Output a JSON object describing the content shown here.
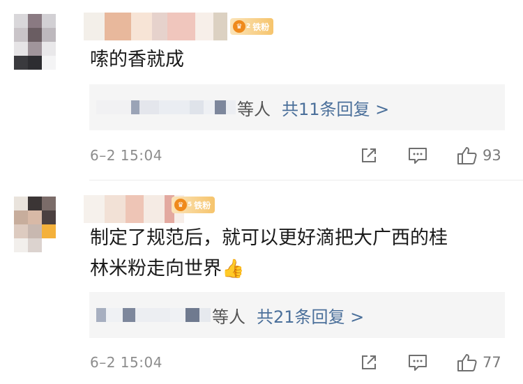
{
  "comments": [
    {
      "badge_label": "铁粉",
      "badge_level": "2",
      "text": "嗦的香就成",
      "reply": {
        "suffix": "等人",
        "link": "共11条回复 >"
      },
      "time": "6–2 15:04",
      "likes": "93"
    },
    {
      "badge_label": "铁粉",
      "badge_level": "5",
      "text_line1": "制定了规范后，就可以更好滴把大广西的桂",
      "text_line2": "林米粉走向世界",
      "emoji": "👍",
      "reply": {
        "suffix": "等人",
        "link": "共21条回复 >"
      },
      "time": "6–2 15:04",
      "likes": "77"
    }
  ],
  "icons": [
    "share-icon",
    "comment-icon",
    "like-icon",
    "crown-icon",
    "thumbs-up-emoji"
  ]
}
